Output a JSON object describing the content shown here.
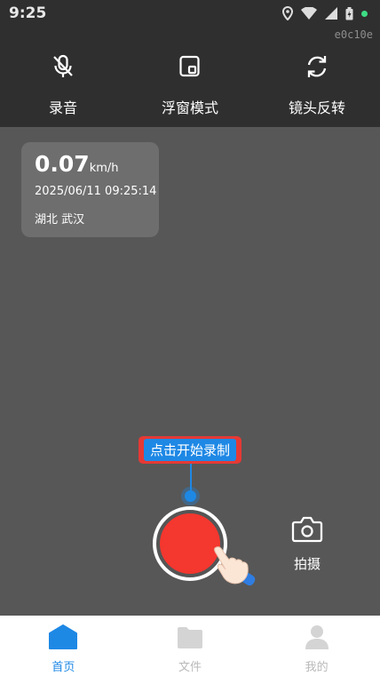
{
  "status_bar": {
    "time": "9:25",
    "build_tag": "e0c10e"
  },
  "toolbar": {
    "items": [
      {
        "label": "录音",
        "icon": "mic-off-icon"
      },
      {
        "label": "浮窗模式",
        "icon": "floating-window-icon"
      },
      {
        "label": "镜头反转",
        "icon": "camera-flip-icon"
      }
    ]
  },
  "info_card": {
    "speed": "0.07",
    "speed_unit": "km/h",
    "datetime": "2025/06/11 09:25:14",
    "location": "湖北 武汉"
  },
  "record": {
    "tip": "点击开始录制",
    "record_color": "#f4372f",
    "tip_color": "#1e88e5"
  },
  "capture": {
    "label": "拍摄",
    "icon": "camera-icon"
  },
  "bottom_nav": {
    "items": [
      {
        "label": "首页",
        "icon": "home-icon",
        "active": true
      },
      {
        "label": "文件",
        "icon": "folder-icon",
        "active": false
      },
      {
        "label": "我的",
        "icon": "profile-icon",
        "active": false
      }
    ]
  }
}
